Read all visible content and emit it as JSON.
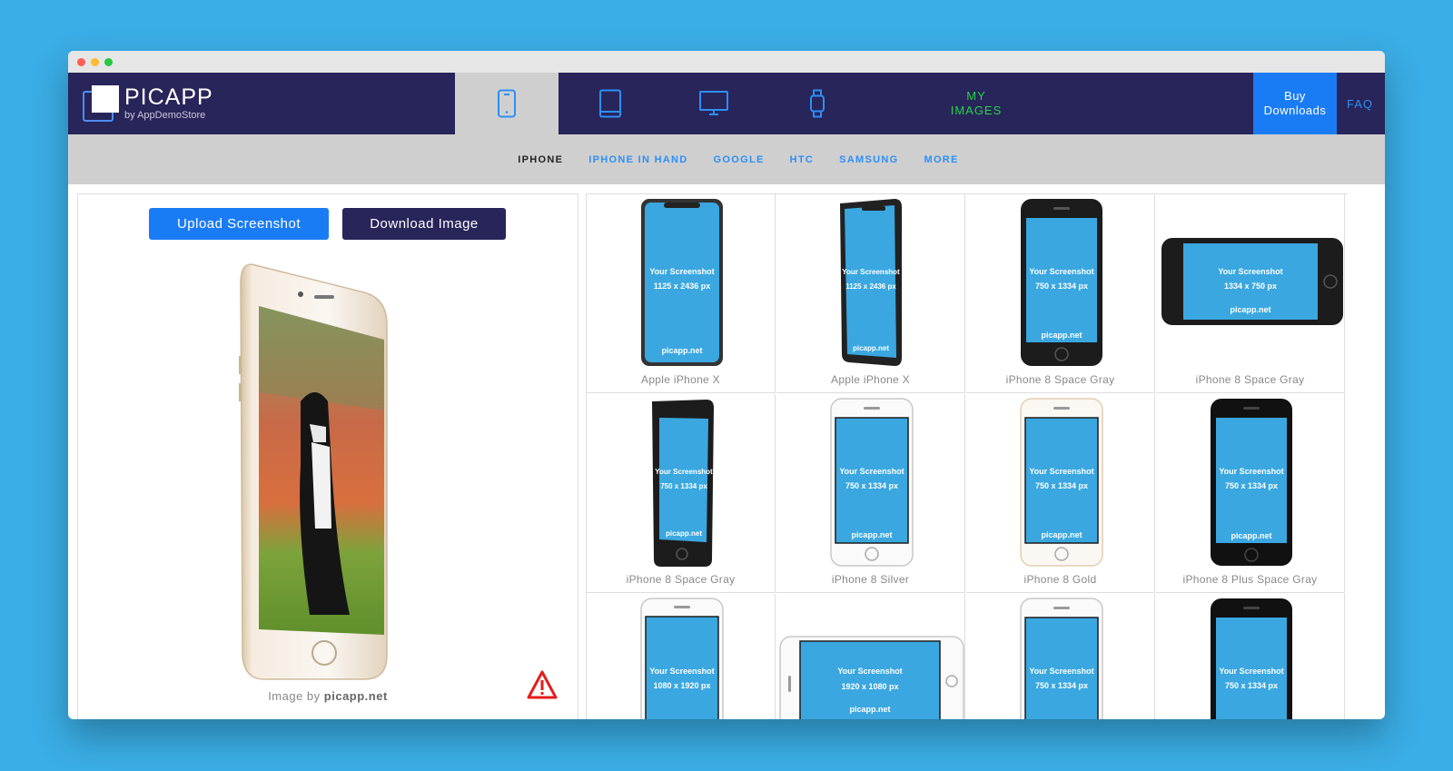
{
  "brand": {
    "name": "PICAPP",
    "tagline": "by AppDemoStore"
  },
  "device_tabs": [
    {
      "icon": "phone-icon",
      "active": true
    },
    {
      "icon": "tablet-icon",
      "active": false
    },
    {
      "icon": "monitor-icon",
      "active": false
    },
    {
      "icon": "watch-icon",
      "active": false
    }
  ],
  "my_images": {
    "line1": "MY",
    "line2": "IMAGES"
  },
  "buy_downloads": {
    "line1": "Buy",
    "line2": "Downloads"
  },
  "faq": "FAQ",
  "subnav": {
    "items": [
      "IPHONE",
      "IPHONE IN HAND",
      "GOOGLE",
      "HTC",
      "SAMSUNG",
      "MORE"
    ],
    "active": "IPHONE"
  },
  "left_panel": {
    "upload_label": "Upload Screenshot",
    "download_label": "Download Image",
    "credit_prefix": "Image by ",
    "credit_site": "picapp.net"
  },
  "mockups": [
    {
      "name": "Apple iPhone X",
      "text1": "Your Screenshot",
      "text2": "1125 x 2436 px",
      "site": "picapp.net"
    },
    {
      "name": "Apple iPhone X",
      "text1": "Your Screenshot",
      "text2": "1125 x 2436 px",
      "site": "picapp.net"
    },
    {
      "name": "iPhone 8 Space Gray",
      "text1": "Your Screenshot",
      "text2": "750 x 1334 px",
      "site": "picapp.net"
    },
    {
      "name": "iPhone 8 Space Gray",
      "text1": "Your Screenshot",
      "text2": "1334 x 750 px",
      "site": "picapp.net"
    },
    {
      "name": "iPhone 8 Space Gray",
      "text1": "Your Screenshot",
      "text2": "750 x 1334 px",
      "site": "picapp.net"
    },
    {
      "name": "iPhone 8 Silver",
      "text1": "Your Screenshot",
      "text2": "750 x 1334 px",
      "site": "picapp.net"
    },
    {
      "name": "iPhone 8 Gold",
      "text1": "Your Screenshot",
      "text2": "750 x 1334 px",
      "site": "picapp.net"
    },
    {
      "name": "iPhone 8 Plus Space Gray",
      "text1": "Your Screenshot",
      "text2": "750 x 1334 px",
      "site": "picapp.net"
    },
    {
      "name": "",
      "text1": "Your Screenshot",
      "text2": "1080 x 1920 px",
      "site": ""
    },
    {
      "name": "",
      "text1": "Your Screenshot",
      "text2": "1920 x 1080 px",
      "site": "picapp.net"
    },
    {
      "name": "",
      "text1": "Your Screenshot",
      "text2": "750 x 1334 px",
      "site": ""
    },
    {
      "name": "",
      "text1": "Your Screenshot",
      "text2": "750 x 1334 px",
      "site": ""
    }
  ],
  "colors": {
    "page_bg": "#3aaee6",
    "nav_dark": "#28255a",
    "accent_blue": "#1a7cf5",
    "screen_blue": "#3aa7e0",
    "my_images_green": "#27d24b"
  }
}
